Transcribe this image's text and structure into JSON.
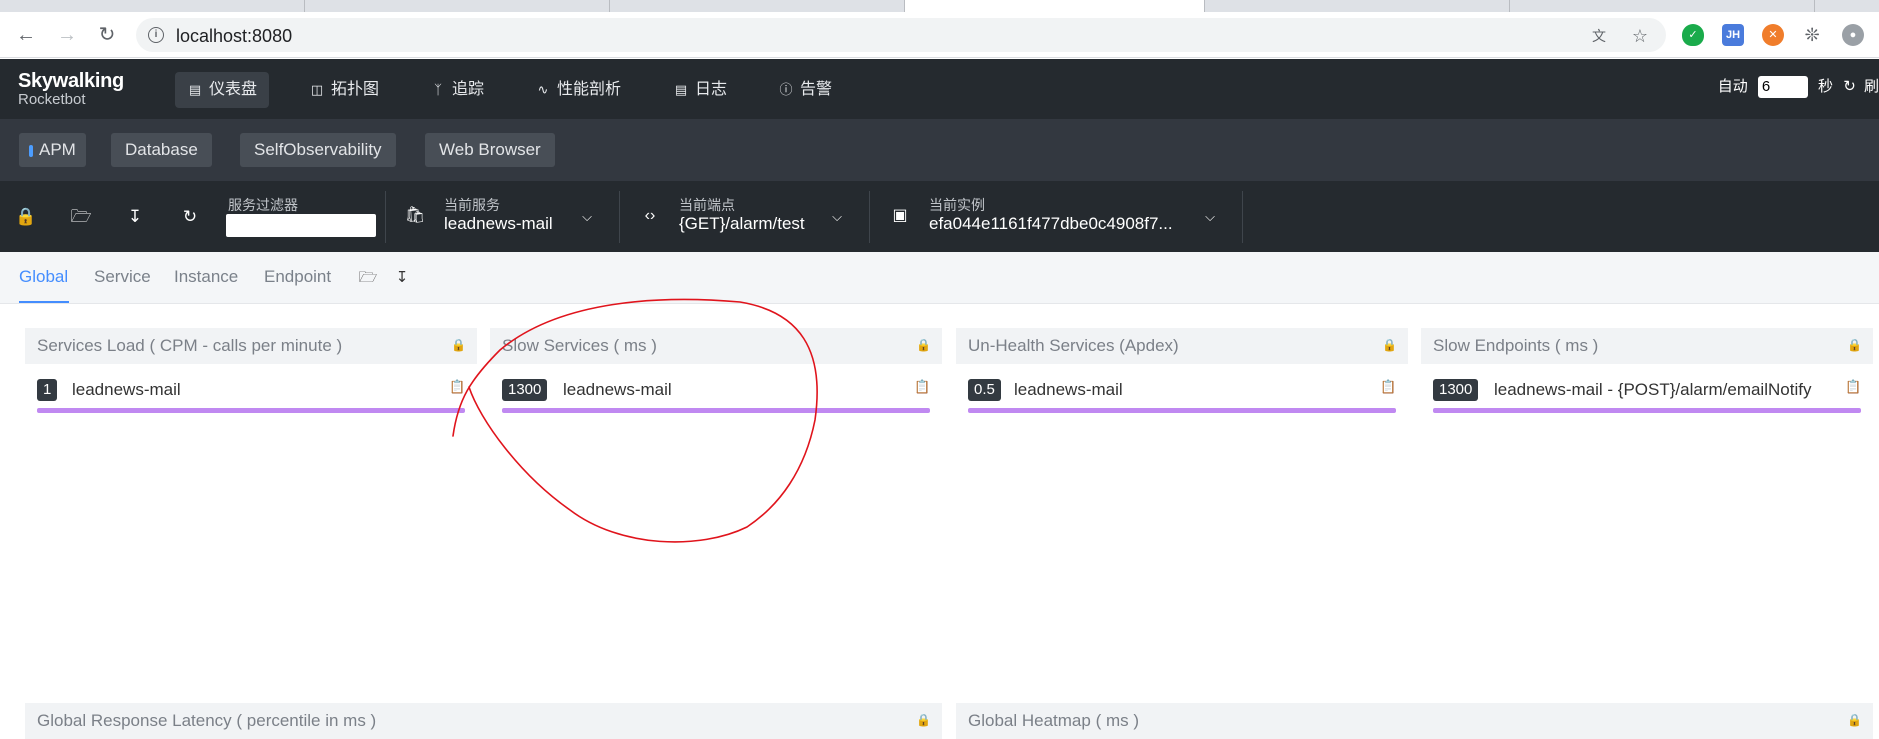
{
  "browser": {
    "url": "localhost:8080",
    "back_icon": "arrow-left-icon",
    "forward_icon": "arrow-right-icon",
    "reload_icon": "reload-icon"
  },
  "header": {
    "logo_title": "Skywalking",
    "logo_subtitle": "Rocketbot",
    "menu": [
      {
        "label": "仪表盘",
        "icon": "dashboard-icon"
      },
      {
        "label": "拓扑图",
        "icon": "topology-icon"
      },
      {
        "label": "追踪",
        "icon": "trace-icon"
      },
      {
        "label": "性能剖析",
        "icon": "profile-icon"
      },
      {
        "label": "日志",
        "icon": "log-icon"
      },
      {
        "label": "告警",
        "icon": "alarm-icon"
      }
    ],
    "auto_label": "自动",
    "auto_value": "6",
    "seconds_label": "秒",
    "refresh_label": "刷"
  },
  "layers": [
    "APM",
    "Database",
    "SelfObservability",
    "Web Browser"
  ],
  "toolbar": {
    "filter_label": "服务过滤器",
    "filter_value": "",
    "service_label": "当前服务",
    "service_value": "leadnews-mail",
    "endpoint_label": "当前端点",
    "endpoint_value": "{GET}/alarm/test",
    "instance_label": "当前实例",
    "instance_value": "efa044e1161f477dbe0c4908f7..."
  },
  "dashboard_tabs": [
    "Global",
    "Service",
    "Instance",
    "Endpoint"
  ],
  "panels": [
    {
      "title": "Services Load ( CPM - calls per minute )",
      "badge": "1",
      "name": "leadnews-mail"
    },
    {
      "title": "Slow Services ( ms )",
      "badge": "1300",
      "name": "leadnews-mail"
    },
    {
      "title": "Un-Health Services (Apdex)",
      "badge": "0.5",
      "name": "leadnews-mail"
    },
    {
      "title": "Slow Endpoints ( ms )",
      "badge": "1300",
      "name": "leadnews-mail - {POST}/alarm/emailNotify"
    }
  ],
  "lower_panels": [
    {
      "title": "Global Response Latency ( percentile in ms )"
    },
    {
      "title": "Global Heatmap ( ms )"
    }
  ],
  "colors": {
    "header_bg": "#252a2f",
    "accent": "#448dfe",
    "bar": "#c089f1",
    "annotation": "#e0141c"
  }
}
